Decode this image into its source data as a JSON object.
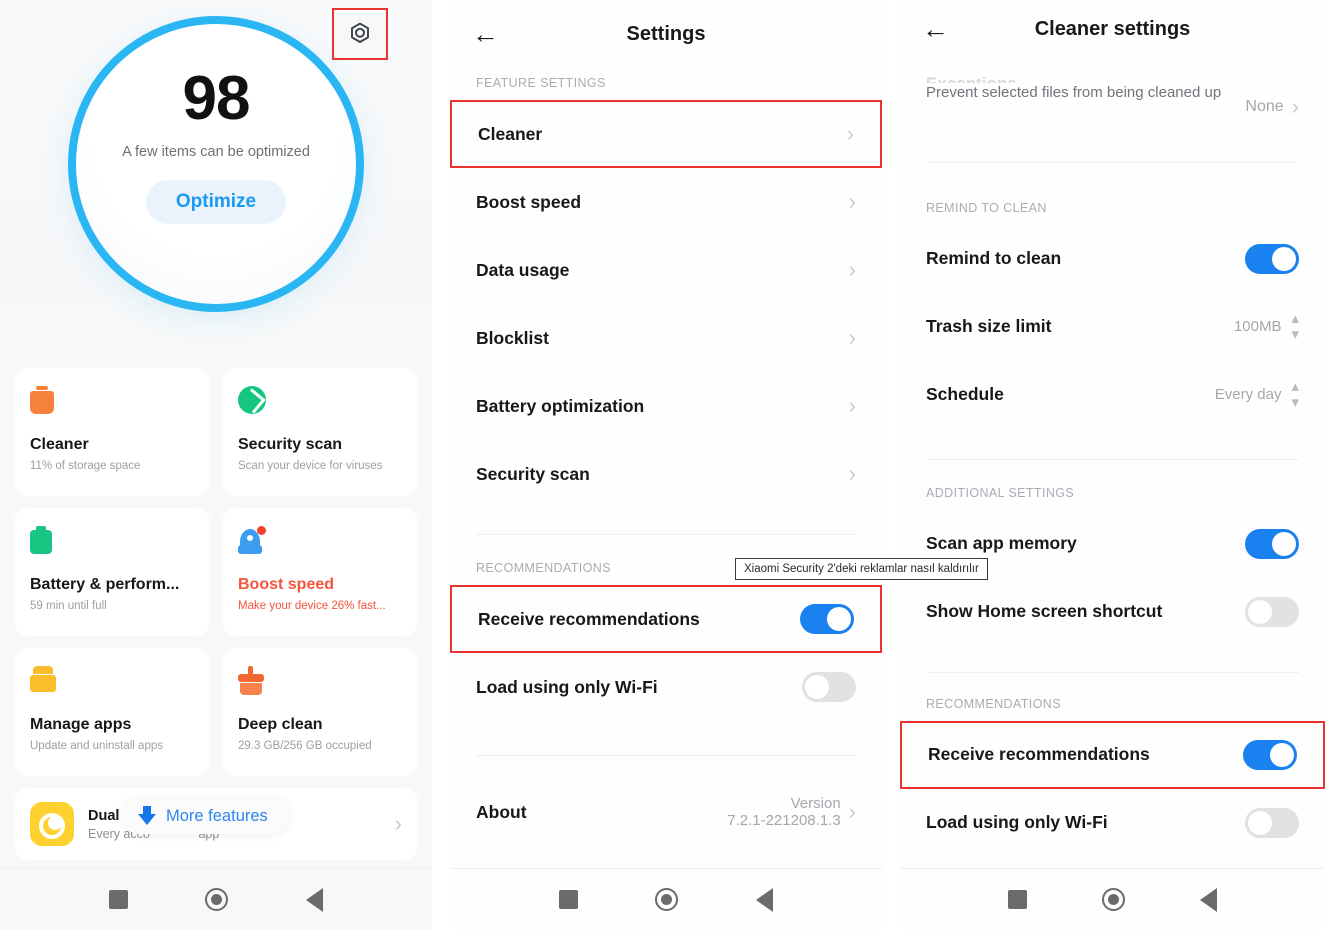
{
  "security_home": {
    "gear_icon": "gear-hex-icon",
    "score": "98",
    "score_caption": "A few items can be optimized",
    "optimize_label": "Optimize",
    "cards": [
      {
        "icon": "trash-icon",
        "title": "Cleaner",
        "subtitle": "11% of storage space",
        "accent": "#f6813c"
      },
      {
        "icon": "shield-check-icon",
        "title": "Security scan",
        "subtitle": "Scan your device for viruses",
        "accent": "#15c77e"
      },
      {
        "icon": "battery-icon",
        "title": "Battery & perform...",
        "subtitle": "59 min  until full",
        "accent": "#19c583"
      },
      {
        "icon": "rocket-icon",
        "title": "Boost speed",
        "subtitle": "Make your device 26% fast...",
        "accent": "#f4543c"
      },
      {
        "icon": "apps-icon",
        "title": "Manage apps",
        "subtitle": "Update and uninstall apps",
        "accent": "#fbbd2b"
      },
      {
        "icon": "broom-icon",
        "title": "Deep clean",
        "subtitle": "29.3 GB/256 GB occupied",
        "accent": "#f0682f"
      }
    ],
    "dual_apps": {
      "title": "Dual ap",
      "subtitle": "Every acco",
      "subtitle_tail": "app"
    },
    "more_features": {
      "label": "More features",
      "icon": "download-arrow-icon"
    }
  },
  "settings": {
    "back_icon": "back-arrow-icon",
    "title": "Settings",
    "feature_group_label": "FEATURE SETTINGS",
    "feature_items": [
      {
        "label": "Cleaner",
        "highlighted": true
      },
      {
        "label": "Boost speed",
        "highlighted": false
      },
      {
        "label": "Data usage",
        "highlighted": false
      },
      {
        "label": "Blocklist",
        "highlighted": false
      },
      {
        "label": "Battery optimization",
        "highlighted": false
      },
      {
        "label": "Security scan",
        "highlighted": false
      }
    ],
    "recommendations_label": "RECOMMENDATIONS",
    "recommendations": [
      {
        "label": "Receive recommendations",
        "state": "on",
        "highlighted": true
      },
      {
        "label": "Load using only Wi-Fi",
        "state": "off",
        "highlighted": false
      }
    ],
    "about": {
      "label": "About",
      "version_line1": "Version",
      "version_line2": "7.2.1-221208.1.3"
    }
  },
  "cleaner_settings": {
    "back_icon": "back-arrow-icon",
    "title": "Cleaner settings",
    "exceptions": {
      "faded_title": "Exceptions",
      "description": "Prevent selected files from being cleaned up",
      "value": "None"
    },
    "remind_group_label": "REMIND TO CLEAN",
    "remind_rows": [
      {
        "label": "Remind to clean",
        "type": "toggle",
        "state": "on"
      },
      {
        "label": "Trash size limit",
        "type": "stepper",
        "value": "100MB"
      },
      {
        "label": "Schedule",
        "type": "stepper",
        "value": "Every day"
      }
    ],
    "additional_group_label": "ADDITIONAL SETTINGS",
    "additional_rows": [
      {
        "label": "Scan app memory",
        "state": "on"
      },
      {
        "label": "Show Home screen shortcut",
        "state": "off"
      }
    ],
    "recommendations_label": "RECOMMENDATIONS",
    "recommendations": [
      {
        "label": "Receive recommendations",
        "state": "on",
        "highlighted": true
      },
      {
        "label": "Load using only Wi-Fi",
        "state": "off",
        "highlighted": false
      }
    ]
  },
  "tooltip": {
    "text": "Xiaomi Security 2'deki reklamlar nasıl kaldırılır"
  },
  "navbar": {
    "recents_icon": "square-icon",
    "home_icon": "circle-icon",
    "back_icon": "triangle-back-icon"
  },
  "colors": {
    "accent_blue": "#1a82f0",
    "ring_blue": "#2ab6f2",
    "highlight_red": "#e8332f",
    "toggle_off": "#dfe1e3"
  }
}
